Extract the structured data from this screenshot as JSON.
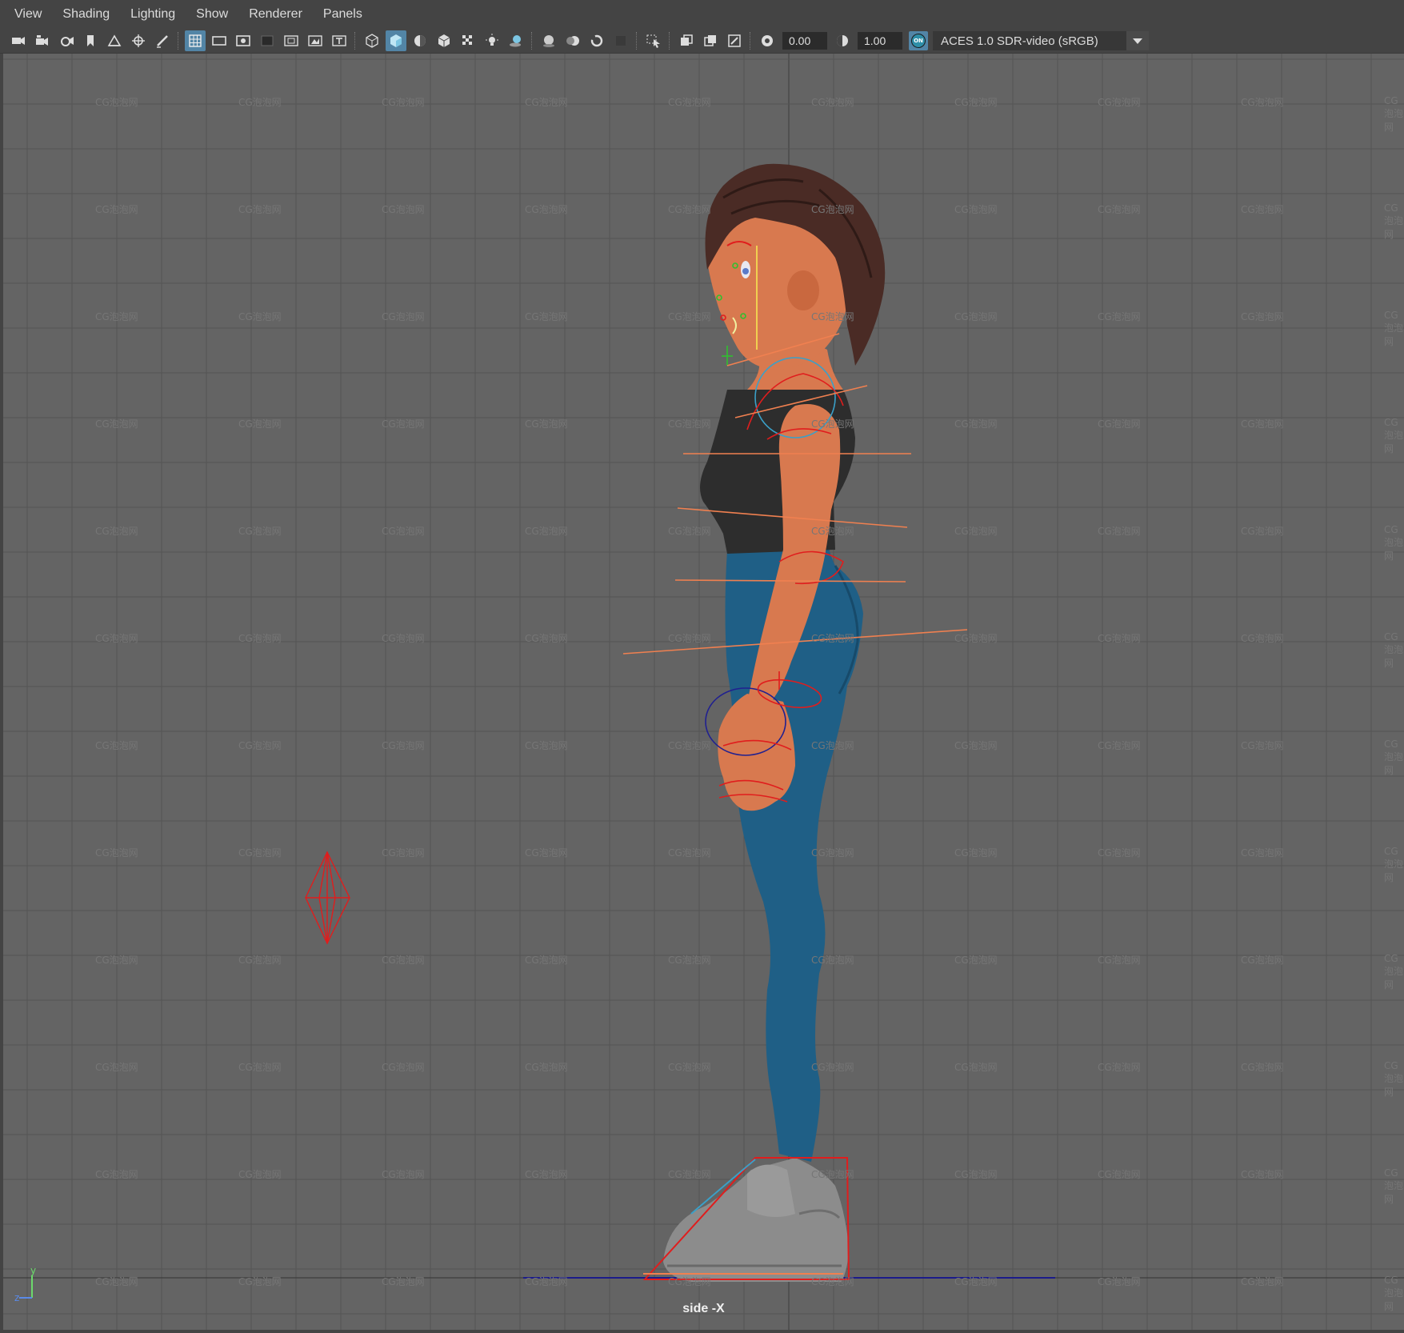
{
  "menu": {
    "items": [
      "View",
      "Shading",
      "Lighting",
      "Show",
      "Renderer",
      "Panels"
    ]
  },
  "toolbar": {
    "exposure_value": "0.00",
    "gamma_value": "1.00",
    "color_mgmt_badge": "ON",
    "color_space": "ACES 1.0 SDR-video (sRGB)"
  },
  "viewport": {
    "camera_label": "side -X",
    "watermark": "CG泡泡网",
    "axis": {
      "y": "y",
      "z": "z"
    },
    "colors": {
      "background": "#646464",
      "grid": "#555555",
      "ground_line": "#1c1c8a",
      "skin": "#d8794f",
      "top": "#2d2d2d",
      "pants": "#1f5f86",
      "shoes": "#8c8c8c",
      "hair": "#4a2b25",
      "rig_red": "#e01d1d",
      "rig_orange": "#f08050"
    }
  }
}
